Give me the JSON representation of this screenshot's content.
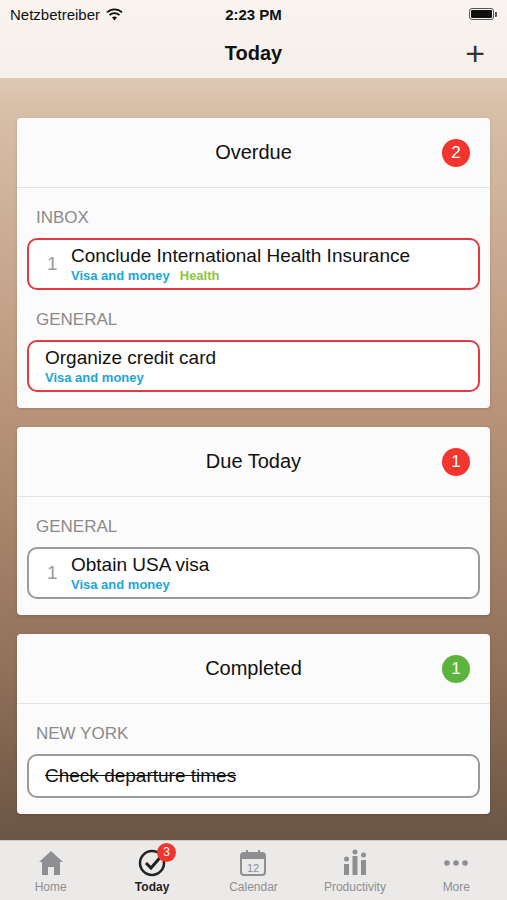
{
  "status_bar": {
    "carrier": "Netzbetreiber",
    "time": "2:23 PM",
    "battery_level": 1
  },
  "nav": {
    "title": "Today",
    "add_button": "+"
  },
  "sections": [
    {
      "title": "Overdue",
      "count": "2",
      "badge_color": "#f2352f",
      "groups": [
        {
          "label": "INBOX",
          "tasks": [
            {
              "number": "1",
              "title": "Conclude International Health Insurance",
              "overdue": true,
              "completed": false,
              "tags": [
                {
                  "label": "Visa and money",
                  "color": "#1ba6d8"
                },
                {
                  "label": "Health",
                  "color": "#8cc63f"
                }
              ]
            }
          ]
        },
        {
          "label": "GENERAL",
          "tasks": [
            {
              "title": "Organize credit card",
              "overdue": true,
              "completed": false,
              "tags": [
                {
                  "label": "Visa and money",
                  "color": "#1ba6d8"
                }
              ]
            }
          ]
        }
      ]
    },
    {
      "title": "Due Today",
      "count": "1",
      "badge_color": "#f2352f",
      "groups": [
        {
          "label": "GENERAL",
          "tasks": [
            {
              "number": "1",
              "title": "Obtain USA visa",
              "overdue": false,
              "completed": false,
              "tags": [
                {
                  "label": "Visa and money",
                  "color": "#1ba6d8"
                }
              ]
            }
          ]
        }
      ]
    },
    {
      "title": "Completed",
      "count": "1",
      "badge_color": "#5db43c",
      "groups": [
        {
          "label": "NEW YORK",
          "tasks": [
            {
              "title": "Check departure times",
              "overdue": false,
              "completed": true,
              "tags": []
            }
          ]
        }
      ]
    }
  ],
  "tab_bar": [
    {
      "label": "Home",
      "selected": false,
      "icon": "home"
    },
    {
      "label": "Today",
      "selected": true,
      "icon": "today",
      "badge": "3"
    },
    {
      "label": "Calendar",
      "selected": false,
      "icon": "calendar",
      "icon_text": "12"
    },
    {
      "label": "Productivity",
      "selected": false,
      "icon": "productivity"
    },
    {
      "label": "More",
      "selected": false,
      "icon": "more"
    }
  ]
}
